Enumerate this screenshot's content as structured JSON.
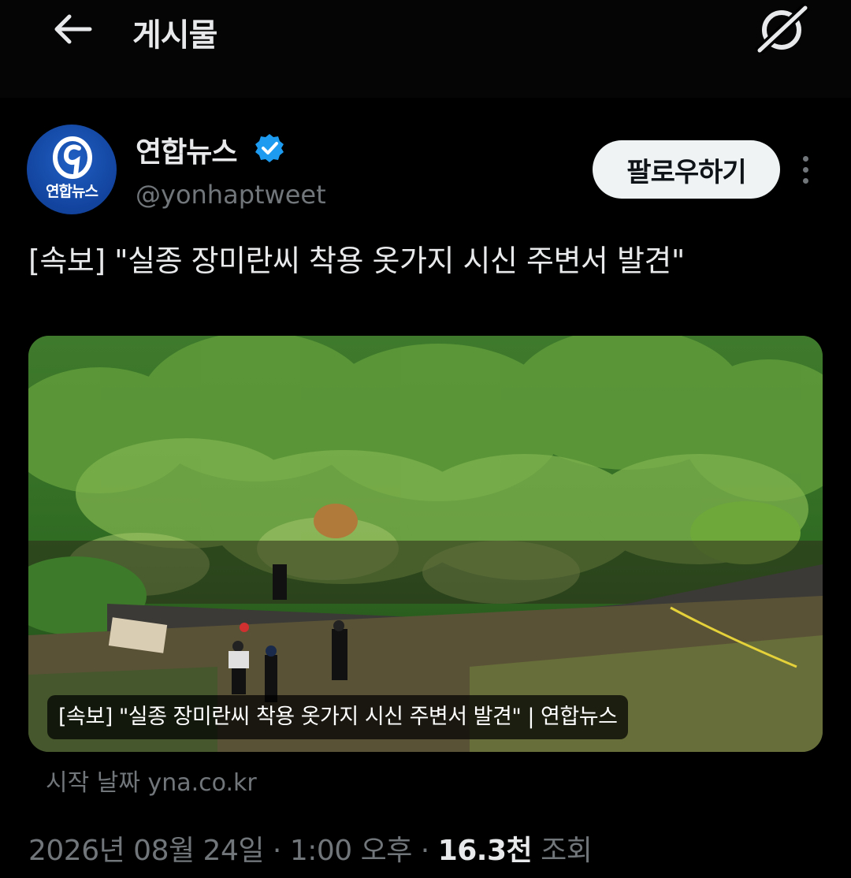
{
  "header": {
    "title": "게시물",
    "back_icon": "arrow-left-icon",
    "grok_icon": "grok-icon"
  },
  "author": {
    "display_name": "연합뉴스",
    "handle": "@yonhaptweet",
    "avatar_text": "연합뉴스",
    "verified": true,
    "verified_color": "#1d9bf0"
  },
  "follow_button_label": "팔로우하기",
  "tweet": {
    "text": "[속보] \"실종 장미란씨 착용 옷가지 시신 주변서 발견\""
  },
  "card": {
    "caption": "[속보] \"실종 장미란씨 착용 옷가지 시신 주변서 발견\" | 연합뉴스",
    "source": "시작 날짜 yna.co.kr"
  },
  "meta": {
    "date": "2026년 08월 24일",
    "sep1": " · ",
    "time": "1:00 오후",
    "sep2": " · ",
    "views": "16.3천",
    "views_label": " 조회"
  },
  "colors": {
    "background": "#000000",
    "text": "#e7e9ea",
    "muted": "#71767b",
    "follow_bg": "#eff3f4"
  }
}
